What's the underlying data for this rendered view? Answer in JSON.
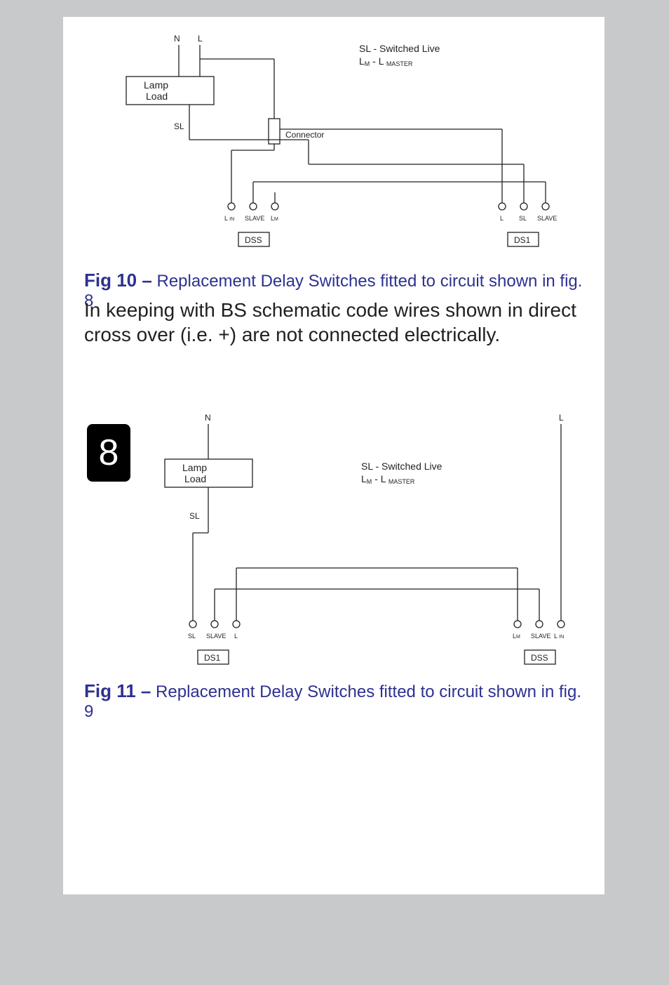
{
  "page_number": "8",
  "fig10": {
    "caption_bold": "Fig 10 –",
    "caption_rest": " Replacement Delay Switches fitted to circuit shown in fig. 8",
    "labels": {
      "N": "N",
      "L": "L",
      "LampLoad_l1": "Lamp",
      "LampLoad_l2": "Load",
      "SL": "SL",
      "Connector": "Connector",
      "legend_l1": "SL - Switched Live",
      "legend_l2a": "L",
      "legend_l2b": "M",
      "legend_l2c": " - L ",
      "legend_l2d": "MASTER",
      "dss_t1a": "L ",
      "dss_t1b": "IN",
      "dss_t2": "SLAVE",
      "dss_t3a": "L",
      "dss_t3b": "M",
      "ds1_t1": "L",
      "ds1_t2": "SL",
      "ds1_t3": "SLAVE",
      "DSS": "DSS",
      "DS1": "DS1"
    }
  },
  "body_text": "In keeping with BS schematic code wires shown in direct cross over (i.e. +) are not connected electrically.",
  "fig11": {
    "caption_bold": "Fig 11 –",
    "caption_rest": " Replacement Delay Switches fitted to circuit shown in fig. 9",
    "labels": {
      "N": "N",
      "L": "L",
      "LampLoad_l1": "Lamp",
      "LampLoad_l2": "Load",
      "SL": "SL",
      "legend_l1": "SL - Switched Live",
      "legend_l2a": "L",
      "legend_l2b": "M",
      "legend_l2c": " - L ",
      "legend_l2d": "MASTER",
      "ds1_t1": "SL",
      "ds1_t2": "SLAVE",
      "ds1_t3": "L",
      "dss_t1a": "L",
      "dss_t1b": "M",
      "dss_t2": "SLAVE",
      "dss_t3a": "L ",
      "dss_t3b": "IN",
      "DS1": "DS1",
      "DSS": "DSS"
    }
  }
}
